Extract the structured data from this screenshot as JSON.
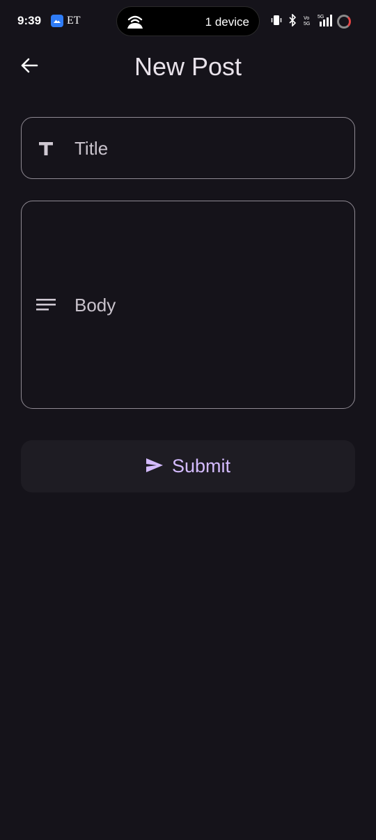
{
  "status_bar": {
    "time": "9:39",
    "carrier_label": "ET",
    "hotspot_text": "1 device"
  },
  "app_bar": {
    "title": "New Post",
    "back_icon": "arrow-left-icon"
  },
  "form": {
    "title_field": {
      "placeholder": "Title",
      "value": "",
      "icon": "text-title-icon"
    },
    "body_field": {
      "placeholder": "Body",
      "value": "",
      "icon": "notes-lines-icon"
    },
    "submit": {
      "label": "Submit",
      "icon": "send-icon"
    }
  },
  "colors": {
    "background": "#15131a",
    "accent": "#d4bbff",
    "outline": "#8f8a93",
    "button_bg": "#1e1c23"
  }
}
